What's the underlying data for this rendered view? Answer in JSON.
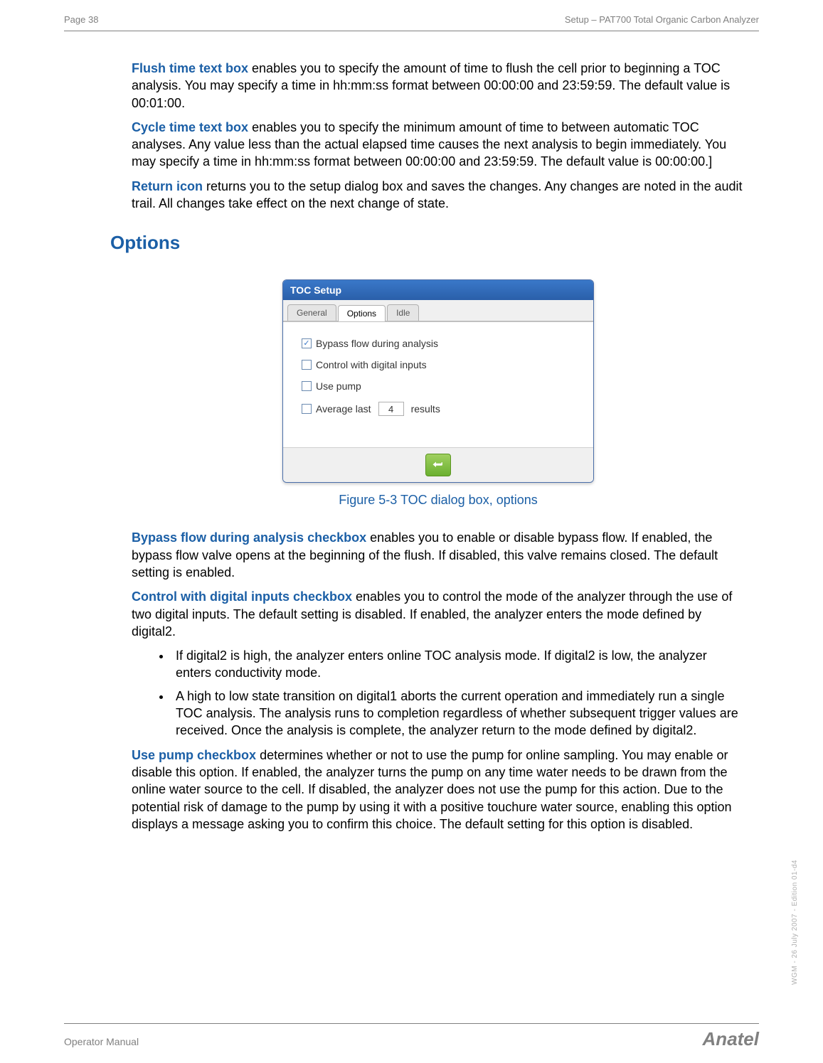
{
  "header": {
    "left": "Page 38",
    "right": "Setup – PAT700 Total Organic Carbon Analyzer"
  },
  "paragraphs": {
    "flush_term": "Flush time text box",
    "flush_text": " enables you to specify the amount of time to flush the cell prior to beginning a TOC analysis. You may specify a time in hh:mm:ss format between 00:00:00 and 23:59:59. The default value is 00:01:00.",
    "cycle_term": "Cycle time text box",
    "cycle_text": " enables you to specify the minimum amount of time to between automatic TOC analyses. Any value less than the actual elapsed time causes the next analysis to begin immediately. You may specify a time in hh:mm:ss format between 00:00:00 and 23:59:59. The default value is 00:00:00.]",
    "return_term": "Return icon",
    "return_text": " returns you to the setup dialog box and saves the changes. Any changes are noted in the audit trail. All changes take effect on the next change of state."
  },
  "section_heading": "Options",
  "dialog": {
    "title": "TOC Setup",
    "tabs": {
      "general": "General",
      "options": "Options",
      "idle": "Idle"
    },
    "checks": {
      "bypass": "Bypass flow during analysis",
      "control": "Control with digital inputs",
      "pump": "Use pump",
      "avg_pre": "Average last",
      "avg_val": "4",
      "avg_post": "results"
    }
  },
  "figure_caption": "Figure 5-3 TOC dialog box, options",
  "body2": {
    "bypass_term": "Bypass flow during analysis checkbox",
    "bypass_text": " enables you to enable or disable bypass flow. If enabled, the bypass flow valve opens at the beginning of the flush. If disabled, this valve remains closed. The default setting is enabled.",
    "control_term": "Control with digital inputs checkbox",
    "control_text": " enables you to control the mode of the analyzer through the use of two digital inputs. The default setting is disabled. If enabled, the analyzer enters the mode defined by digital2.",
    "bullet1": "If digital2 is high, the analyzer enters online TOC analysis mode. If digital2 is low, the analyzer enters conductivity mode.",
    "bullet2": "A high to low state transition on digital1 aborts the current operation and immediately run a single TOC analysis. The analysis runs to completion regardless of whether subsequent trigger values are received. Once the analysis is complete, the analyzer return to the mode defined by digital2.",
    "pump_term": "Use pump checkbox",
    "pump_text": " determines whether or not to use the pump for online sampling. You may enable or disable this option. If enabled, the analyzer turns the pump on any time water needs to be drawn from the online water source to the cell. If disabled, the analyzer does not use the pump for this action. Due to the potential risk of damage to the pump by using it with a positive touchure water source, enabling this option displays a message asking you to confirm this choice. The default setting for this option is disabled."
  },
  "footer": {
    "left": "Operator Manual",
    "right": "Anatel"
  },
  "side": "WGM - 26 July 2007 - Edition 01-d4"
}
